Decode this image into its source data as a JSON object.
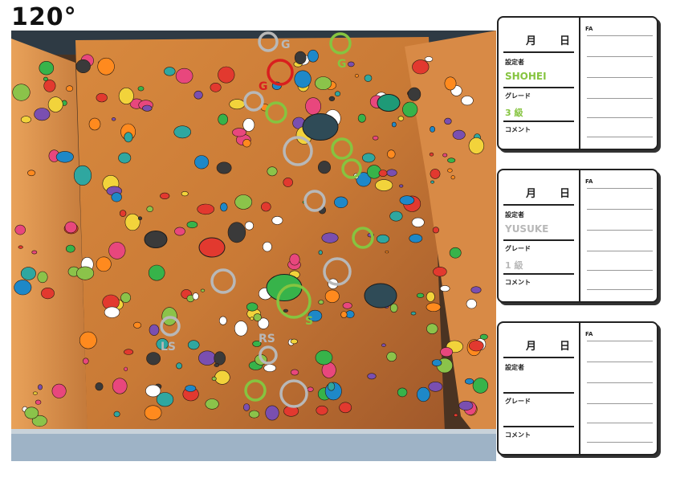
{
  "header": {
    "angle": "120°"
  },
  "wall": {
    "markers": [
      {
        "text": "G",
        "color": "#b8b8b8"
      },
      {
        "text": "G",
        "color": "#86c440"
      },
      {
        "text": "G",
        "color": "#d91e1e"
      },
      {
        "text": "S",
        "color": "#86c440"
      },
      {
        "text": "LS",
        "color": "#b8b8b8"
      },
      {
        "text": "RS",
        "color": "#b8b8b8"
      }
    ]
  },
  "labels": {
    "month": "月",
    "day": "日",
    "setter": "設定者",
    "grade": "グレード",
    "comment": "コメント",
    "fa": "FA"
  },
  "cards": [
    {
      "setter": "SHOHEI",
      "grade": "3 級",
      "color": "#86c440"
    },
    {
      "setter": "YUSUKE",
      "grade": "1 級",
      "color": "#b8b8b8"
    },
    {
      "setter": "",
      "grade": "",
      "color": "#222222"
    }
  ]
}
